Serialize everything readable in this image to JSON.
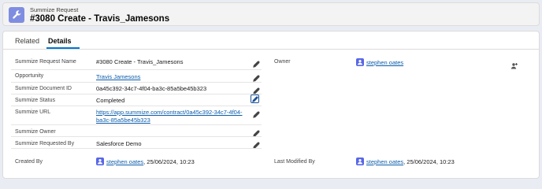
{
  "header": {
    "object_label": "Summize Request",
    "title": "#3080 Create - Travis_Jamesons"
  },
  "tabs": [
    {
      "label": "Related",
      "active": false
    },
    {
      "label": "Details",
      "active": true
    }
  ],
  "fields": {
    "request_name": {
      "label": "Summize Request Name",
      "value": "#3080 Create - Travis_Jamesons"
    },
    "opportunity": {
      "label": "Opportunity",
      "value": "Travis Jamesons"
    },
    "document_id": {
      "label": "Summize Document ID",
      "value": "0a45c392-34c7-4f04-ba3c-85a5be45b323"
    },
    "status": {
      "label": "Summize Status",
      "value": "Completed"
    },
    "url": {
      "label": "Summize URL",
      "value": "https://app.summize.com/contract/0a45c392-34c7-4f04-ba3c-85a5be45b323"
    },
    "owner_summize": {
      "label": "Summize Owner",
      "value": ""
    },
    "requested_by": {
      "label": "Summize Requested By",
      "value": "Salesforce Demo"
    },
    "owner": {
      "label": "Owner",
      "value": "stephen oates"
    },
    "created_by": {
      "label": "Created By",
      "user": "stephen oates",
      "date": ", 25/06/2024, 10:23"
    },
    "last_modified_by": {
      "label": "Last Modified By",
      "user": "stephen oates",
      "date": ", 25/06/2024, 10:23"
    }
  },
  "colors": {
    "accent": "#0176d3",
    "link": "#0b5cab",
    "header_icon": "#7f8de1",
    "avatar": "#5867e8"
  },
  "icons": {
    "header": "wrench-icon",
    "edit": "pencil-icon",
    "avatar": "user-avatar-icon",
    "change_owner": "change-owner-icon"
  }
}
